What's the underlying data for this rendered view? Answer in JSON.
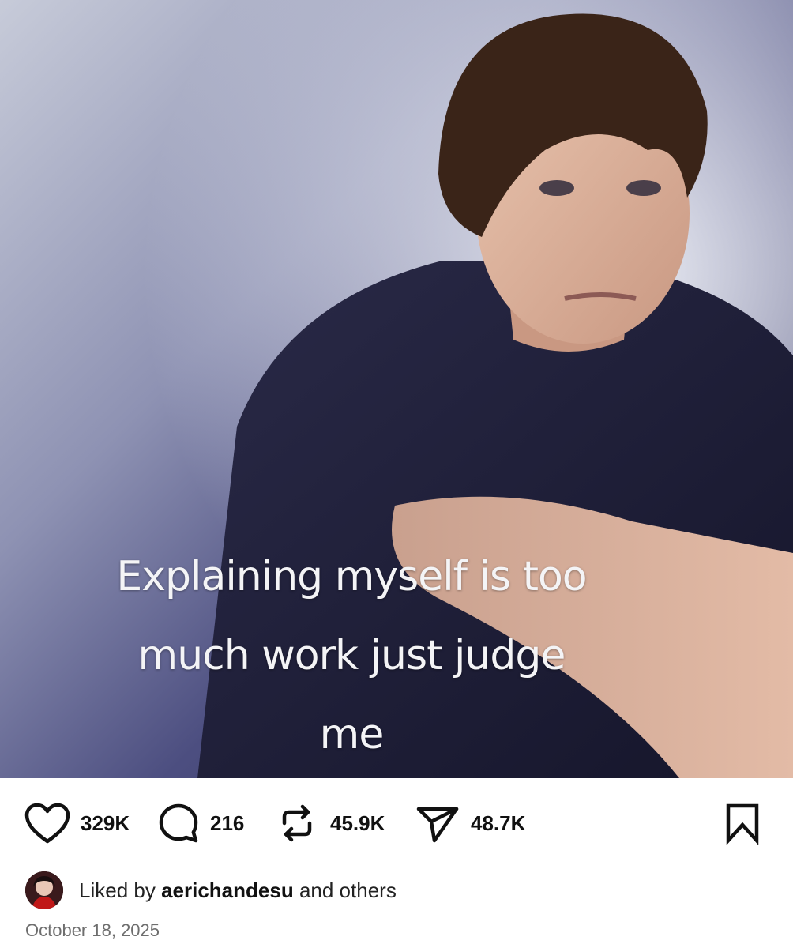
{
  "post": {
    "caption": "Explaining myself is  too\nmuch work just judge\nme"
  },
  "actions": {
    "likes": "329K",
    "comments": "216",
    "reposts": "45.9K",
    "shares": "48.7K",
    "icons": [
      "heart-icon",
      "comment-icon",
      "repost-icon",
      "send-icon",
      "bookmark-icon"
    ]
  },
  "liked_by": {
    "prefix": "Liked by",
    "user": "aerichandesu",
    "suffix": "and others"
  },
  "date": "October 18, 2025",
  "colors": {
    "text": "#111111",
    "muted": "#6e6e6e",
    "background": "#ffffff"
  }
}
